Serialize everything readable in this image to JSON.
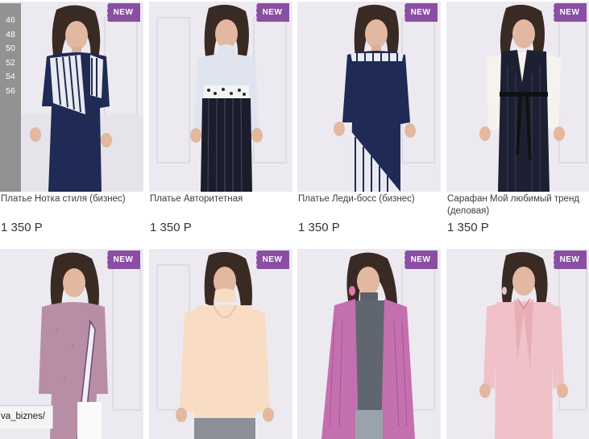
{
  "badge_label": "NEW",
  "badge_color": "#8a4fa3",
  "size_overlay": [
    "46",
    "48",
    "50",
    "52",
    "54",
    "56"
  ],
  "products": [
    {
      "name": "Платье Нотка стиля (бизнес)",
      "price": "1 350 Р",
      "style": "navy-stripe-dress"
    },
    {
      "name": "Платье Авторитетная",
      "price": "1 350 Р",
      "style": "lightblue-pinstripe-dress"
    },
    {
      "name": "Платье Леди-босс (бизнес)",
      "price": "1 350 Р",
      "style": "navy-diagonal-dress"
    },
    {
      "name": "Сарафан Мой любимый тренд (деловая)",
      "price": "1 350 Р",
      "style": "white-blouse-sarafan"
    },
    {
      "name": "",
      "price": "",
      "style": "pink-tunic"
    },
    {
      "name": "",
      "price": "",
      "style": "cream-blouse"
    },
    {
      "name": "",
      "price": "",
      "style": "purple-cardigan"
    },
    {
      "name": "",
      "price": "",
      "style": "pink-bow-blouse"
    }
  ],
  "status_link": "va_biznes/"
}
